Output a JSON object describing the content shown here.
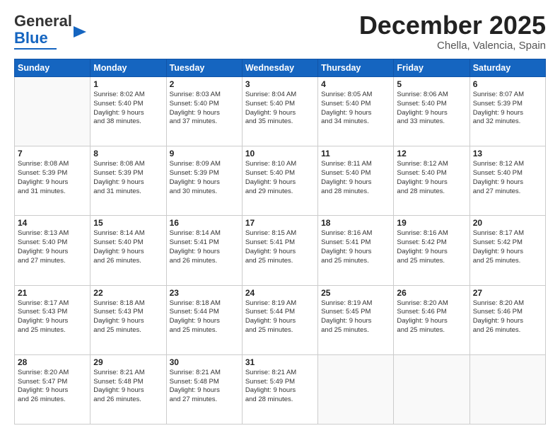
{
  "header": {
    "logo_line1": "General",
    "logo_line2": "Blue",
    "month": "December 2025",
    "location": "Chella, Valencia, Spain"
  },
  "days_of_week": [
    "Sunday",
    "Monday",
    "Tuesday",
    "Wednesday",
    "Thursday",
    "Friday",
    "Saturday"
  ],
  "weeks": [
    [
      {
        "day": "",
        "info": ""
      },
      {
        "day": "1",
        "info": "Sunrise: 8:02 AM\nSunset: 5:40 PM\nDaylight: 9 hours\nand 38 minutes."
      },
      {
        "day": "2",
        "info": "Sunrise: 8:03 AM\nSunset: 5:40 PM\nDaylight: 9 hours\nand 37 minutes."
      },
      {
        "day": "3",
        "info": "Sunrise: 8:04 AM\nSunset: 5:40 PM\nDaylight: 9 hours\nand 35 minutes."
      },
      {
        "day": "4",
        "info": "Sunrise: 8:05 AM\nSunset: 5:40 PM\nDaylight: 9 hours\nand 34 minutes."
      },
      {
        "day": "5",
        "info": "Sunrise: 8:06 AM\nSunset: 5:40 PM\nDaylight: 9 hours\nand 33 minutes."
      },
      {
        "day": "6",
        "info": "Sunrise: 8:07 AM\nSunset: 5:39 PM\nDaylight: 9 hours\nand 32 minutes."
      }
    ],
    [
      {
        "day": "7",
        "info": "Sunrise: 8:08 AM\nSunset: 5:39 PM\nDaylight: 9 hours\nand 31 minutes."
      },
      {
        "day": "8",
        "info": "Sunrise: 8:08 AM\nSunset: 5:39 PM\nDaylight: 9 hours\nand 31 minutes."
      },
      {
        "day": "9",
        "info": "Sunrise: 8:09 AM\nSunset: 5:39 PM\nDaylight: 9 hours\nand 30 minutes."
      },
      {
        "day": "10",
        "info": "Sunrise: 8:10 AM\nSunset: 5:40 PM\nDaylight: 9 hours\nand 29 minutes."
      },
      {
        "day": "11",
        "info": "Sunrise: 8:11 AM\nSunset: 5:40 PM\nDaylight: 9 hours\nand 28 minutes."
      },
      {
        "day": "12",
        "info": "Sunrise: 8:12 AM\nSunset: 5:40 PM\nDaylight: 9 hours\nand 28 minutes."
      },
      {
        "day": "13",
        "info": "Sunrise: 8:12 AM\nSunset: 5:40 PM\nDaylight: 9 hours\nand 27 minutes."
      }
    ],
    [
      {
        "day": "14",
        "info": "Sunrise: 8:13 AM\nSunset: 5:40 PM\nDaylight: 9 hours\nand 27 minutes."
      },
      {
        "day": "15",
        "info": "Sunrise: 8:14 AM\nSunset: 5:40 PM\nDaylight: 9 hours\nand 26 minutes."
      },
      {
        "day": "16",
        "info": "Sunrise: 8:14 AM\nSunset: 5:41 PM\nDaylight: 9 hours\nand 26 minutes."
      },
      {
        "day": "17",
        "info": "Sunrise: 8:15 AM\nSunset: 5:41 PM\nDaylight: 9 hours\nand 25 minutes."
      },
      {
        "day": "18",
        "info": "Sunrise: 8:16 AM\nSunset: 5:41 PM\nDaylight: 9 hours\nand 25 minutes."
      },
      {
        "day": "19",
        "info": "Sunrise: 8:16 AM\nSunset: 5:42 PM\nDaylight: 9 hours\nand 25 minutes."
      },
      {
        "day": "20",
        "info": "Sunrise: 8:17 AM\nSunset: 5:42 PM\nDaylight: 9 hours\nand 25 minutes."
      }
    ],
    [
      {
        "day": "21",
        "info": "Sunrise: 8:17 AM\nSunset: 5:43 PM\nDaylight: 9 hours\nand 25 minutes."
      },
      {
        "day": "22",
        "info": "Sunrise: 8:18 AM\nSunset: 5:43 PM\nDaylight: 9 hours\nand 25 minutes."
      },
      {
        "day": "23",
        "info": "Sunrise: 8:18 AM\nSunset: 5:44 PM\nDaylight: 9 hours\nand 25 minutes."
      },
      {
        "day": "24",
        "info": "Sunrise: 8:19 AM\nSunset: 5:44 PM\nDaylight: 9 hours\nand 25 minutes."
      },
      {
        "day": "25",
        "info": "Sunrise: 8:19 AM\nSunset: 5:45 PM\nDaylight: 9 hours\nand 25 minutes."
      },
      {
        "day": "26",
        "info": "Sunrise: 8:20 AM\nSunset: 5:46 PM\nDaylight: 9 hours\nand 25 minutes."
      },
      {
        "day": "27",
        "info": "Sunrise: 8:20 AM\nSunset: 5:46 PM\nDaylight: 9 hours\nand 26 minutes."
      }
    ],
    [
      {
        "day": "28",
        "info": "Sunrise: 8:20 AM\nSunset: 5:47 PM\nDaylight: 9 hours\nand 26 minutes."
      },
      {
        "day": "29",
        "info": "Sunrise: 8:21 AM\nSunset: 5:48 PM\nDaylight: 9 hours\nand 26 minutes."
      },
      {
        "day": "30",
        "info": "Sunrise: 8:21 AM\nSunset: 5:48 PM\nDaylight: 9 hours\nand 27 minutes."
      },
      {
        "day": "31",
        "info": "Sunrise: 8:21 AM\nSunset: 5:49 PM\nDaylight: 9 hours\nand 28 minutes."
      },
      {
        "day": "",
        "info": ""
      },
      {
        "day": "",
        "info": ""
      },
      {
        "day": "",
        "info": ""
      }
    ]
  ]
}
